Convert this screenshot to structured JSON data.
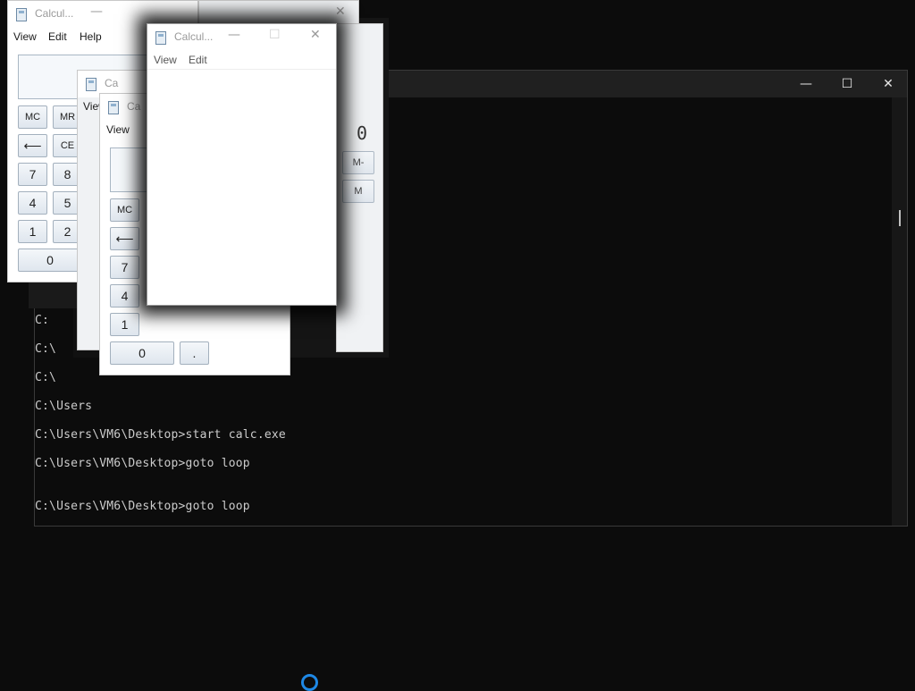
{
  "console": {
    "window_controls": {
      "minimize": "—",
      "maximize": "☐",
      "close": "✕"
    },
    "partial_lines": [
      "C:",
      "C:\\",
      "C:\\",
      "C:\\Users"
    ],
    "lines": [
      "C:\\Users\\VM6\\Desktop>start calc.exe",
      "C:\\Users\\VM6\\Desktop>goto loop",
      "C:\\Users\\VM6\\Desktop>goto loop"
    ]
  },
  "calc_back": {
    "title": "Calcul...",
    "menu": [
      "View",
      "Edit",
      "Help"
    ],
    "keys_row1": [
      "MC",
      "MR"
    ],
    "keys_row2": [
      "⟵",
      "CE"
    ],
    "digits_col1": [
      "7",
      "4",
      "1"
    ],
    "digits_col2": [
      "8",
      "5",
      "2"
    ],
    "zero": "0"
  },
  "calc_right": {
    "display_value": "0",
    "keys": [
      "M-",
      "M"
    ]
  },
  "calc_mid": {
    "title": "Ca",
    "menu": [
      "View"
    ]
  },
  "calc_front_left": {
    "title": "Ca",
    "menu": [
      "View"
    ],
    "keys_row1": [
      "MC"
    ],
    "keys_row2": [
      "⟵"
    ],
    "digits": [
      "7",
      "4",
      "1"
    ],
    "zero": "0",
    "dot": "."
  },
  "calc_top": {
    "title": "Calcul...",
    "window_controls": {
      "minimize": "—",
      "maximize": "☐",
      "close": "✕"
    },
    "menu": [
      "View",
      "Edit"
    ]
  },
  "colors": {
    "console_bg": "#0c0c0c",
    "console_text": "#cccccc",
    "taskbar_ring": "#1e88e5"
  }
}
